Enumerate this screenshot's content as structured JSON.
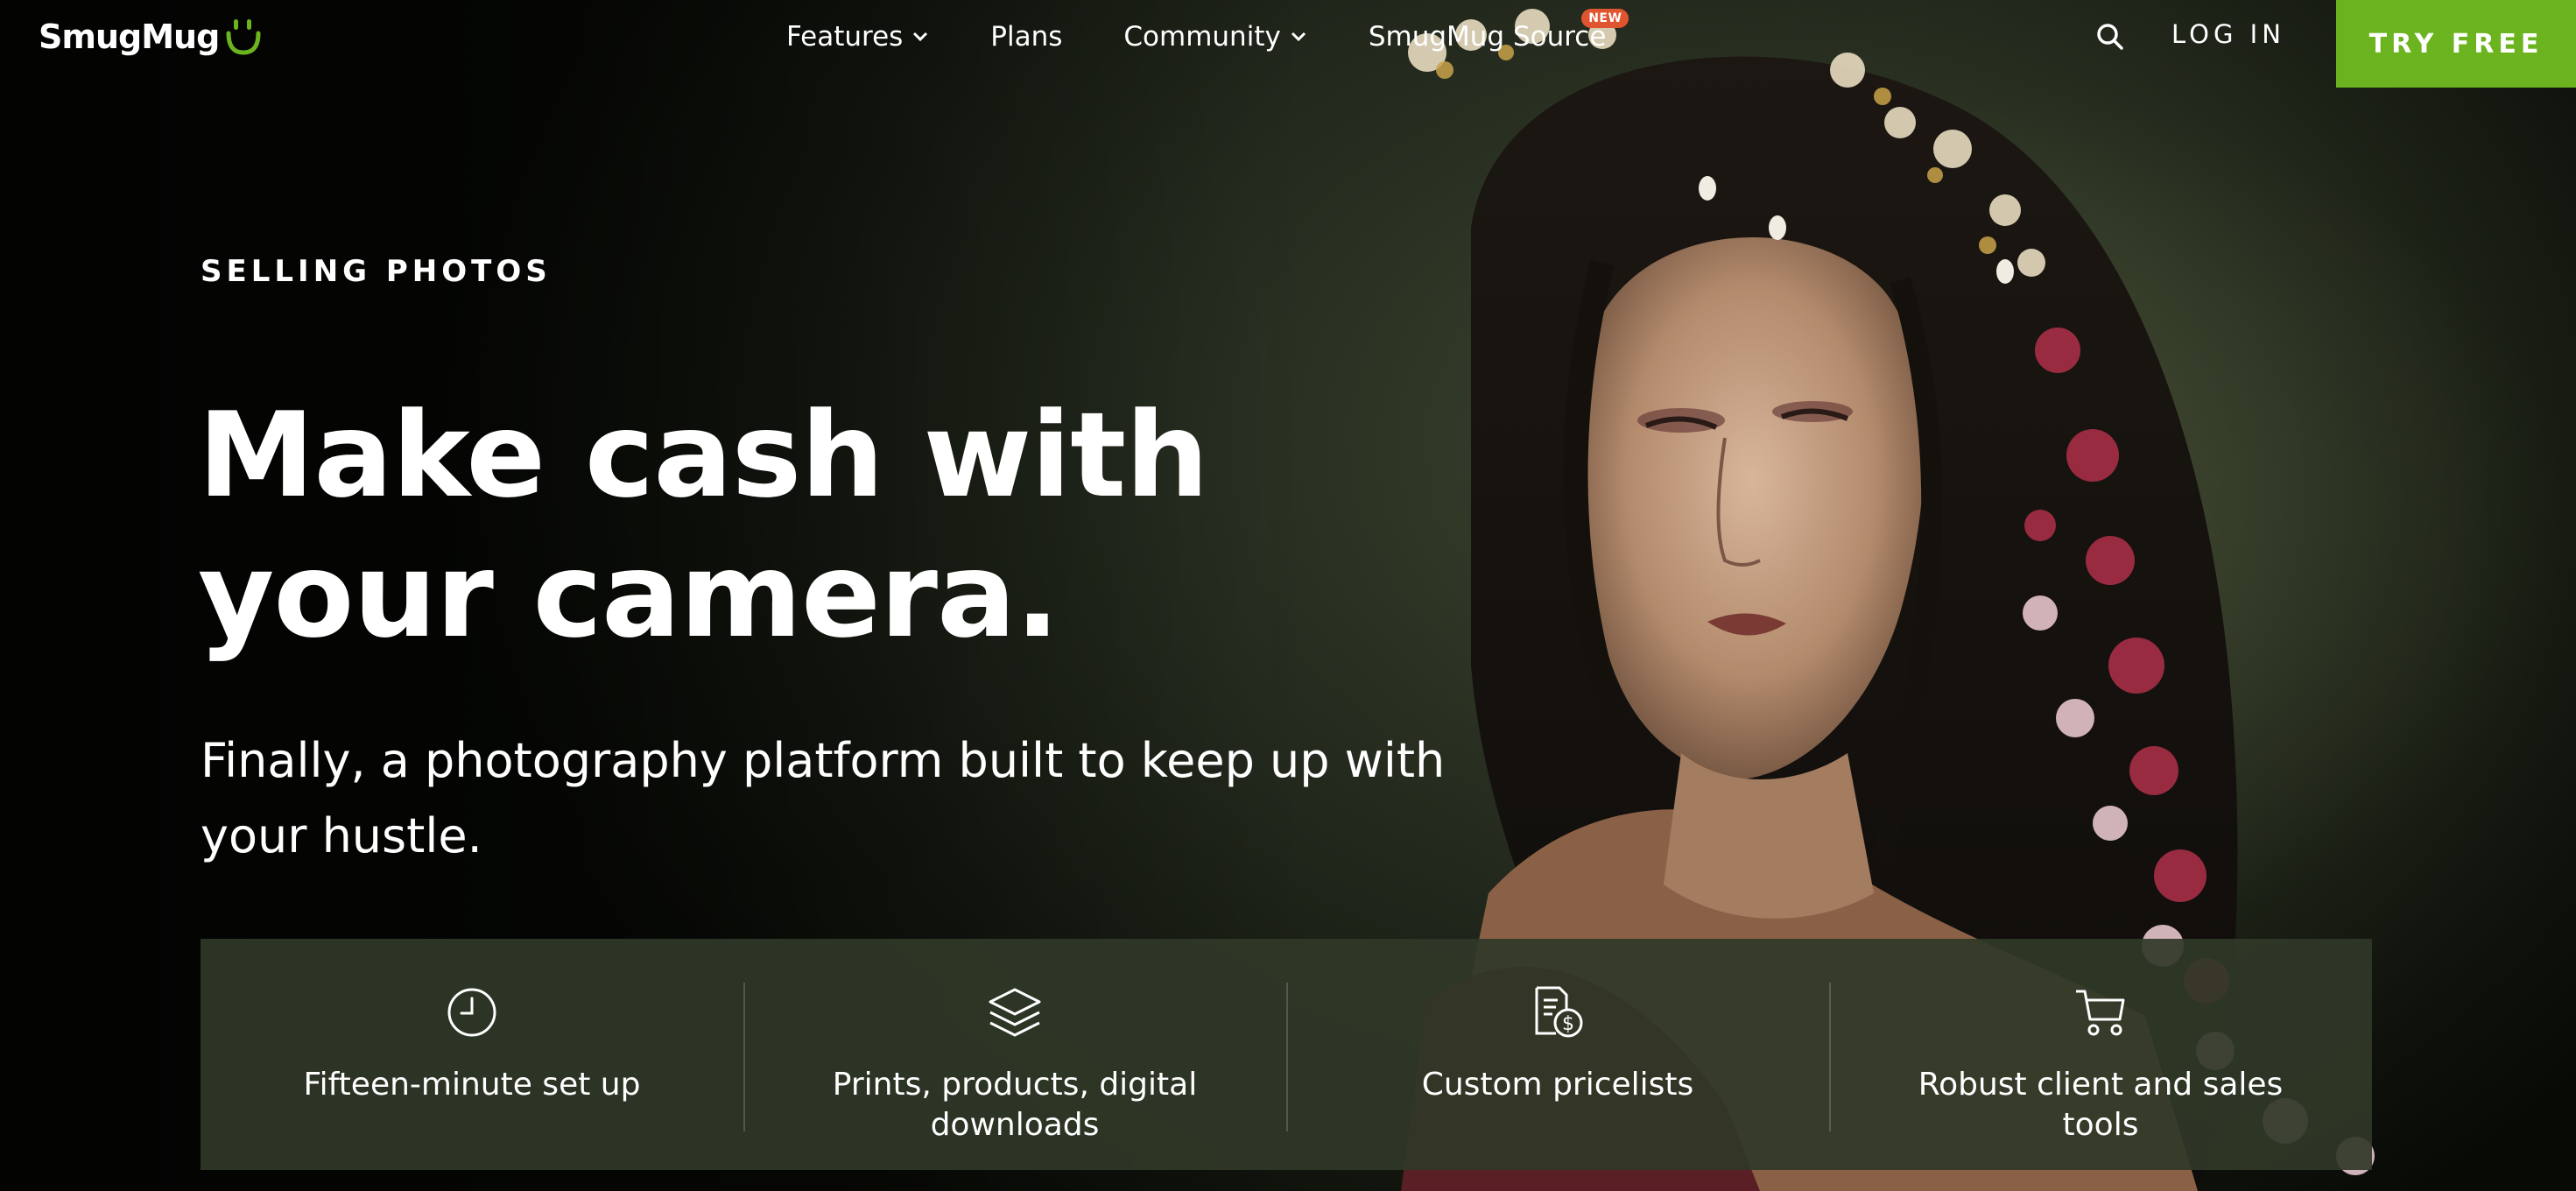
{
  "header": {
    "logo_text": "SmugMug",
    "nav": [
      {
        "label": "Features",
        "has_dropdown": true
      },
      {
        "label": "Plans",
        "has_dropdown": false
      },
      {
        "label": "Community",
        "has_dropdown": true
      },
      {
        "label": "SmugMug Source",
        "has_dropdown": false,
        "badge": "NEW"
      }
    ],
    "search_icon": "search-icon",
    "login_label": "LOG IN",
    "cta_label": "TRY FREE"
  },
  "hero": {
    "eyebrow": "SELLING PHOTOS",
    "headline": "Make cash with your camera.",
    "subhead": "Finally, a photography platform built to keep up with your hustle."
  },
  "features": [
    {
      "icon": "clock-icon",
      "label": "Fifteen-minute set up"
    },
    {
      "icon": "layers-icon",
      "label": "Prints, products, digital downloads"
    },
    {
      "icon": "pricelist-icon",
      "label": "Custom pricelists"
    },
    {
      "icon": "cart-icon",
      "label": "Robust client and sales tools"
    }
  ],
  "colors": {
    "accent_green": "#6cb41f",
    "badge_orange": "#e0542f",
    "feature_bar": "#303828"
  }
}
